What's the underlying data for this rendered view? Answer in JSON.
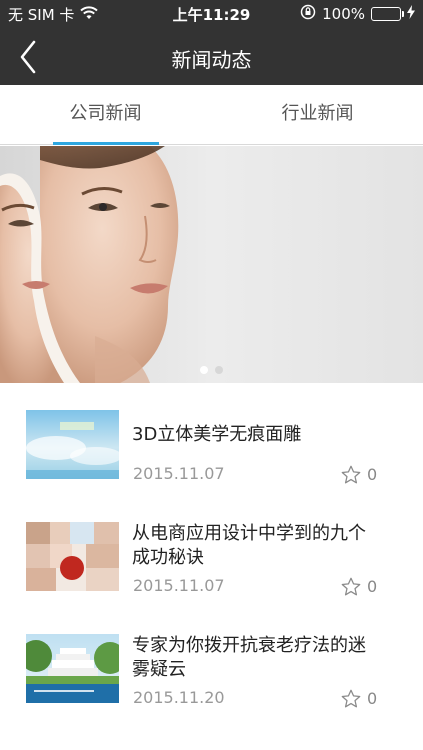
{
  "status_bar": {
    "carrier": "无 SIM 卡",
    "time": "上午11:29",
    "battery": "100%",
    "battery_level": 1.0
  },
  "nav": {
    "title": "新闻动态",
    "back_icon": "chevron-left-icon"
  },
  "tabs": [
    {
      "label": "公司新闻",
      "active": true
    },
    {
      "label": "行业新闻",
      "active": false
    }
  ],
  "banner": {
    "slide_count": 2,
    "active_slide": 0
  },
  "news": [
    {
      "title": "3D立体美学无痕面雕",
      "date": "2015.11.07",
      "favorites": "0"
    },
    {
      "title": "从电商应用设计中学到的九个成功秘诀",
      "date": "2015.11.07",
      "favorites": "0"
    },
    {
      "title": "专家为你拨开抗衰老疗法的迷雾疑云",
      "date": "2015.11.20",
      "favorites": "0"
    }
  ],
  "colors": {
    "bar": "#333333",
    "accent": "#2ea7e0",
    "battery": "#4cd964"
  }
}
